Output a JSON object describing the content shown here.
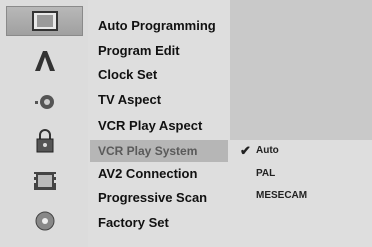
{
  "sidebar": {
    "icons": [
      {
        "name": "setup-icon",
        "active": true
      },
      {
        "name": "language-icon",
        "active": false
      },
      {
        "name": "audio-icon",
        "active": false
      },
      {
        "name": "lock-icon",
        "active": false
      },
      {
        "name": "recording-icon",
        "active": false
      },
      {
        "name": "disc-icon",
        "active": false
      }
    ]
  },
  "menu": {
    "items": [
      {
        "label": "Auto Programming"
      },
      {
        "label": "Program Edit"
      },
      {
        "label": "Clock Set"
      },
      {
        "label": "TV Aspect"
      },
      {
        "label": "VCR Play Aspect"
      },
      {
        "label": "VCR Play System",
        "selected": true
      },
      {
        "label": "AV2 Connection"
      },
      {
        "label": "Progressive Scan"
      },
      {
        "label": "Factory Set"
      }
    ]
  },
  "options": {
    "items": [
      {
        "label": "Auto",
        "checked": true
      },
      {
        "label": "PAL",
        "checked": false
      },
      {
        "label": "MESECAM",
        "checked": false
      }
    ],
    "check_glyph": "✔"
  }
}
